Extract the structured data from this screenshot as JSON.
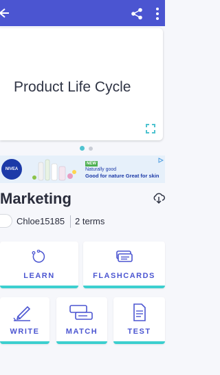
{
  "appbar": {
    "back_icon": "arrow-left-icon",
    "share_icon": "share-icon",
    "more_icon": "more-vert-icon",
    "bg": "#4b55d1"
  },
  "card": {
    "term": "Product Life Cycle",
    "expand_icon": "fullscreen-icon",
    "page_index": 1,
    "page_count": 2
  },
  "ad": {
    "brand": "NIVEA",
    "badge": "NEW",
    "line1": "Naturally good",
    "line2": "Good for nature Great for skin",
    "adchoice_icon": "play-triangle-icon"
  },
  "set": {
    "title": "Marketing",
    "download_icon": "cloud-download-icon",
    "creator": "Chloe15185",
    "term_count": "2 terms"
  },
  "modes": {
    "learn": {
      "label": "LEARN",
      "icon": "learn-cycle-icon"
    },
    "flashcards": {
      "label": "FLASHCARDS",
      "icon": "flashcards-icon"
    },
    "write": {
      "label": "WRITE",
      "icon": "pen-write-icon"
    },
    "match": {
      "label": "MATCH",
      "icon": "match-cards-icon"
    },
    "test": {
      "label": "TEST",
      "icon": "test-document-icon"
    }
  },
  "colors": {
    "accent": "#4b55d1",
    "teal": "#3ccfcf"
  }
}
